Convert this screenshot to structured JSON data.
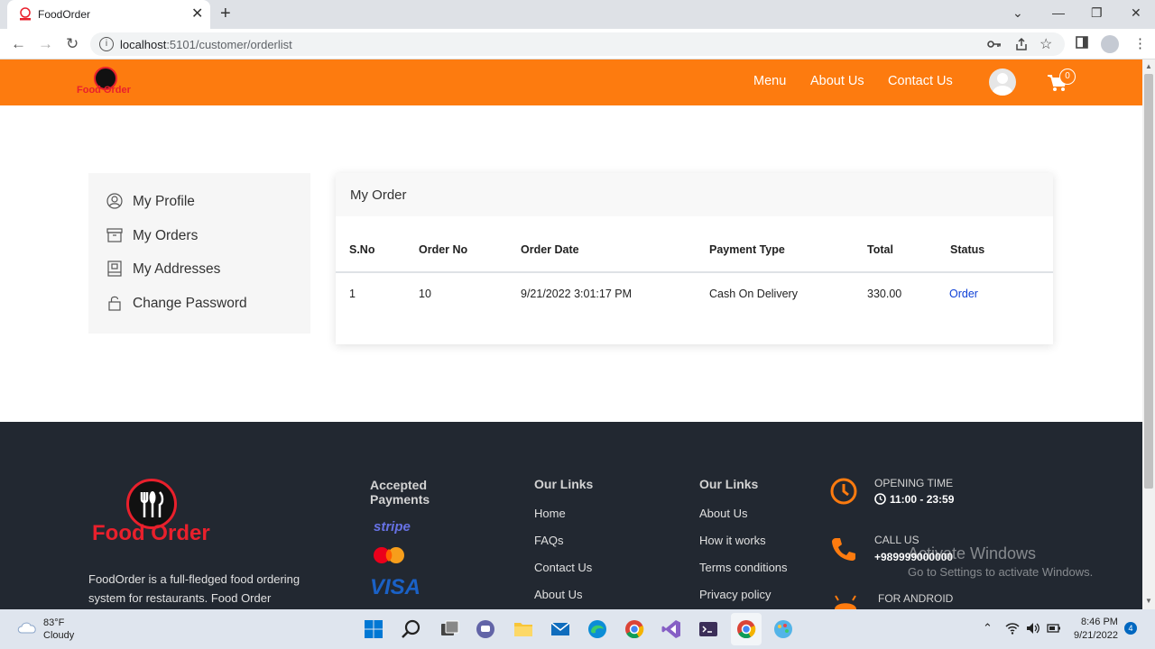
{
  "browser": {
    "tab_title": "FoodOrder",
    "tab_close": "✕",
    "new_tab": "+",
    "url_host": "localhost",
    "url_path": ":5101/customer/orderlist",
    "win_minimize": "—",
    "win_restore": "❐",
    "win_close": "✕",
    "win_dropdown": "⌄"
  },
  "header": {
    "logo_text": "Food Order",
    "nav": [
      "Menu",
      "About Us",
      "Contact Us"
    ],
    "cart_count": "0",
    "accent_color": "#fd7b0f"
  },
  "sidebar": {
    "items": [
      {
        "label": "My Profile",
        "icon": "user-circle-icon"
      },
      {
        "label": "My Orders",
        "icon": "archive-box-icon"
      },
      {
        "label": "My Addresses",
        "icon": "address-book-icon"
      },
      {
        "label": "Change Password",
        "icon": "lock-icon"
      }
    ]
  },
  "orders": {
    "title": "My Order",
    "columns": [
      "S.No",
      "Order No",
      "Order Date",
      "Payment Type",
      "Total",
      "Status"
    ],
    "rows": [
      {
        "sno": "1",
        "order_no": "10",
        "order_date": "9/21/2022 3:01:17 PM",
        "payment_type": "Cash On Delivery",
        "total": "330.00",
        "status": "Order"
      }
    ]
  },
  "footer": {
    "logo_text": "Food Order",
    "description": "FoodOrder is a full-fledged food ordering system for restaurants. Food Order",
    "payments_heading": "Accepted Payments",
    "stripe_label": "stripe",
    "visa_label": "VISA",
    "links1_heading": "Our Links",
    "links1": [
      "Home",
      "FAQs",
      "Contact Us",
      "About Us"
    ],
    "links2_heading": "Our Links",
    "links2": [
      "About Us",
      "How it works",
      "Terms conditions",
      "Privacy policy"
    ],
    "opening_label": "OPENING TIME",
    "opening_value": "11:00 - 23:59",
    "call_label": "CALL US",
    "call_value": "+989999000000",
    "android_label": "FOR ANDROID"
  },
  "watermark": {
    "line1": "Activate Windows",
    "line2": "Go to Settings to activate Windows."
  },
  "taskbar": {
    "weather_temp": "83°F",
    "weather_cond": "Cloudy",
    "time": "8:46 PM",
    "date": "9/21/2022",
    "notifications": "4"
  }
}
